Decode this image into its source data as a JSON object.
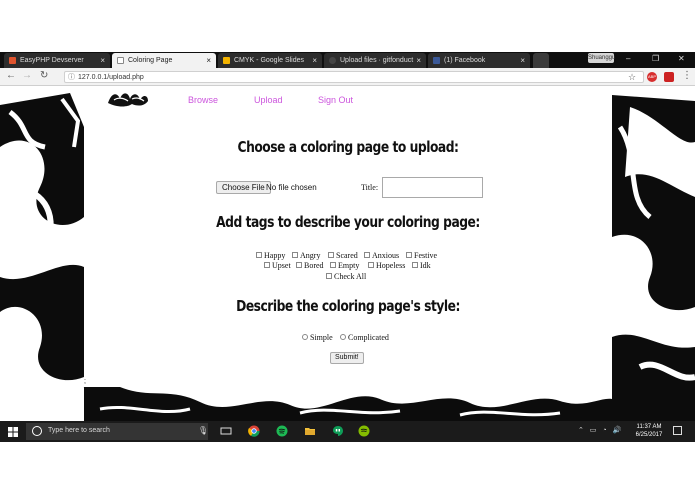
{
  "browser": {
    "tabs": [
      {
        "label": "EasyPHP Devserver",
        "favicon_color": "#e0542e"
      },
      {
        "label": "Coloring Page",
        "favicon_color": "#bbbbbb"
      },
      {
        "label": "CMYK - Google Slides",
        "favicon_color": "#f4b400"
      },
      {
        "label": "Upload files · gitfonduct",
        "favicon_color": "#444444"
      },
      {
        "label": "(1) Facebook",
        "favicon_color": "#3b5998"
      }
    ],
    "active_tab": 1,
    "user_chip": "Shuanggu",
    "url": "127.0.0.1/upload.php"
  },
  "site": {
    "nav": [
      "Browse",
      "Upload",
      "Sign Out"
    ],
    "nav_color": "#cc55dd"
  },
  "upload": {
    "heading": "Choose a coloring page to upload:",
    "choose_file": "Choose File",
    "file_status": "No file chosen",
    "title_label": "Title:",
    "title_value": ""
  },
  "tags": {
    "heading": "Add tags to describe your coloring page:",
    "rows": [
      [
        "Happy",
        "Angry",
        "Scared",
        "Anxious",
        "Festive"
      ],
      [
        "Upset",
        "Bored",
        "Empty",
        "Hopeless",
        "Idk"
      ],
      [
        "Check All"
      ]
    ]
  },
  "style": {
    "heading": "Describe the coloring page's style:",
    "options": [
      "Simple",
      "Complicated"
    ]
  },
  "submit": "Submit!",
  "stray_char": ";",
  "taskbar": {
    "search_placeholder": "Type here to search",
    "time": "11:37 AM",
    "date": "6/25/2017"
  }
}
